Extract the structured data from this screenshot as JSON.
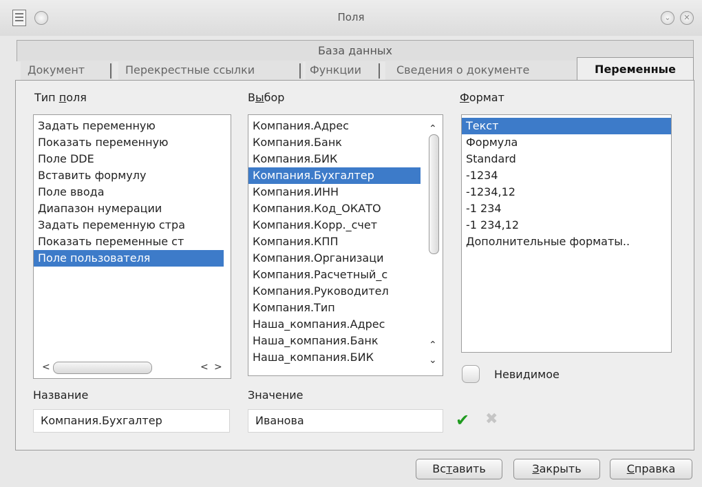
{
  "window": {
    "title": "Поля"
  },
  "tabs": {
    "top": "База данных",
    "row": [
      "Документ",
      "Перекрестные ссылки",
      "Функции",
      "Сведения о документе"
    ],
    "active": "Переменные"
  },
  "type_field": {
    "label_prefix": "Тип ",
    "label_ul": "п",
    "label_suffix": "оля",
    "items": [
      "Задать переменную",
      "Показать переменную",
      "Поле DDE",
      "Вставить формулу",
      "Поле ввода",
      "Диапазон нумерации",
      "Задать переменную стра",
      "Показать переменные ст",
      "Поле пользователя"
    ],
    "selected_index": 8
  },
  "selection": {
    "label_prefix": "В",
    "label_ul": "ы",
    "label_suffix": "бор",
    "items": [
      "Компания.Адрес",
      "Компания.Банк",
      "Компания.БИК",
      "Компания.Бухгалтер",
      "Компания.ИНН",
      "Компания.Код_ОКАТО",
      "Компания.Корр._счет",
      "Компания.КПП",
      "Компания.Организаци",
      "Компания.Расчетный_с",
      "Компания.Руководител",
      "Компания.Тип",
      "Наша_компания.Адрес",
      "Наша_компания.Банк",
      "Наша_компания.БИК"
    ],
    "selected_index": 3
  },
  "format": {
    "label_ul": "Ф",
    "label_suffix": "ормат",
    "items": [
      "Текст",
      "Формула",
      "Standard",
      "-1234",
      "-1234,12",
      "-1 234",
      "-1 234,12",
      "Дополнительные форматы.."
    ],
    "selected_index": 0
  },
  "invisible": {
    "prefix": "Неви",
    "ul": "д",
    "suffix": "имое",
    "checked": false
  },
  "name": {
    "label": "Название",
    "value": "Компания.Бухгалтер"
  },
  "value": {
    "label": "Значение",
    "value": "Иванова"
  },
  "buttons": {
    "insert": {
      "prefix": "Вс",
      "ul": "т",
      "suffix": "авить"
    },
    "close": {
      "ul": "З",
      "suffix": "акрыть"
    },
    "help": {
      "ul": "С",
      "suffix": "правка"
    }
  },
  "colors": {
    "selection": "#3d7bc9",
    "apply": "#1f9b1f"
  }
}
